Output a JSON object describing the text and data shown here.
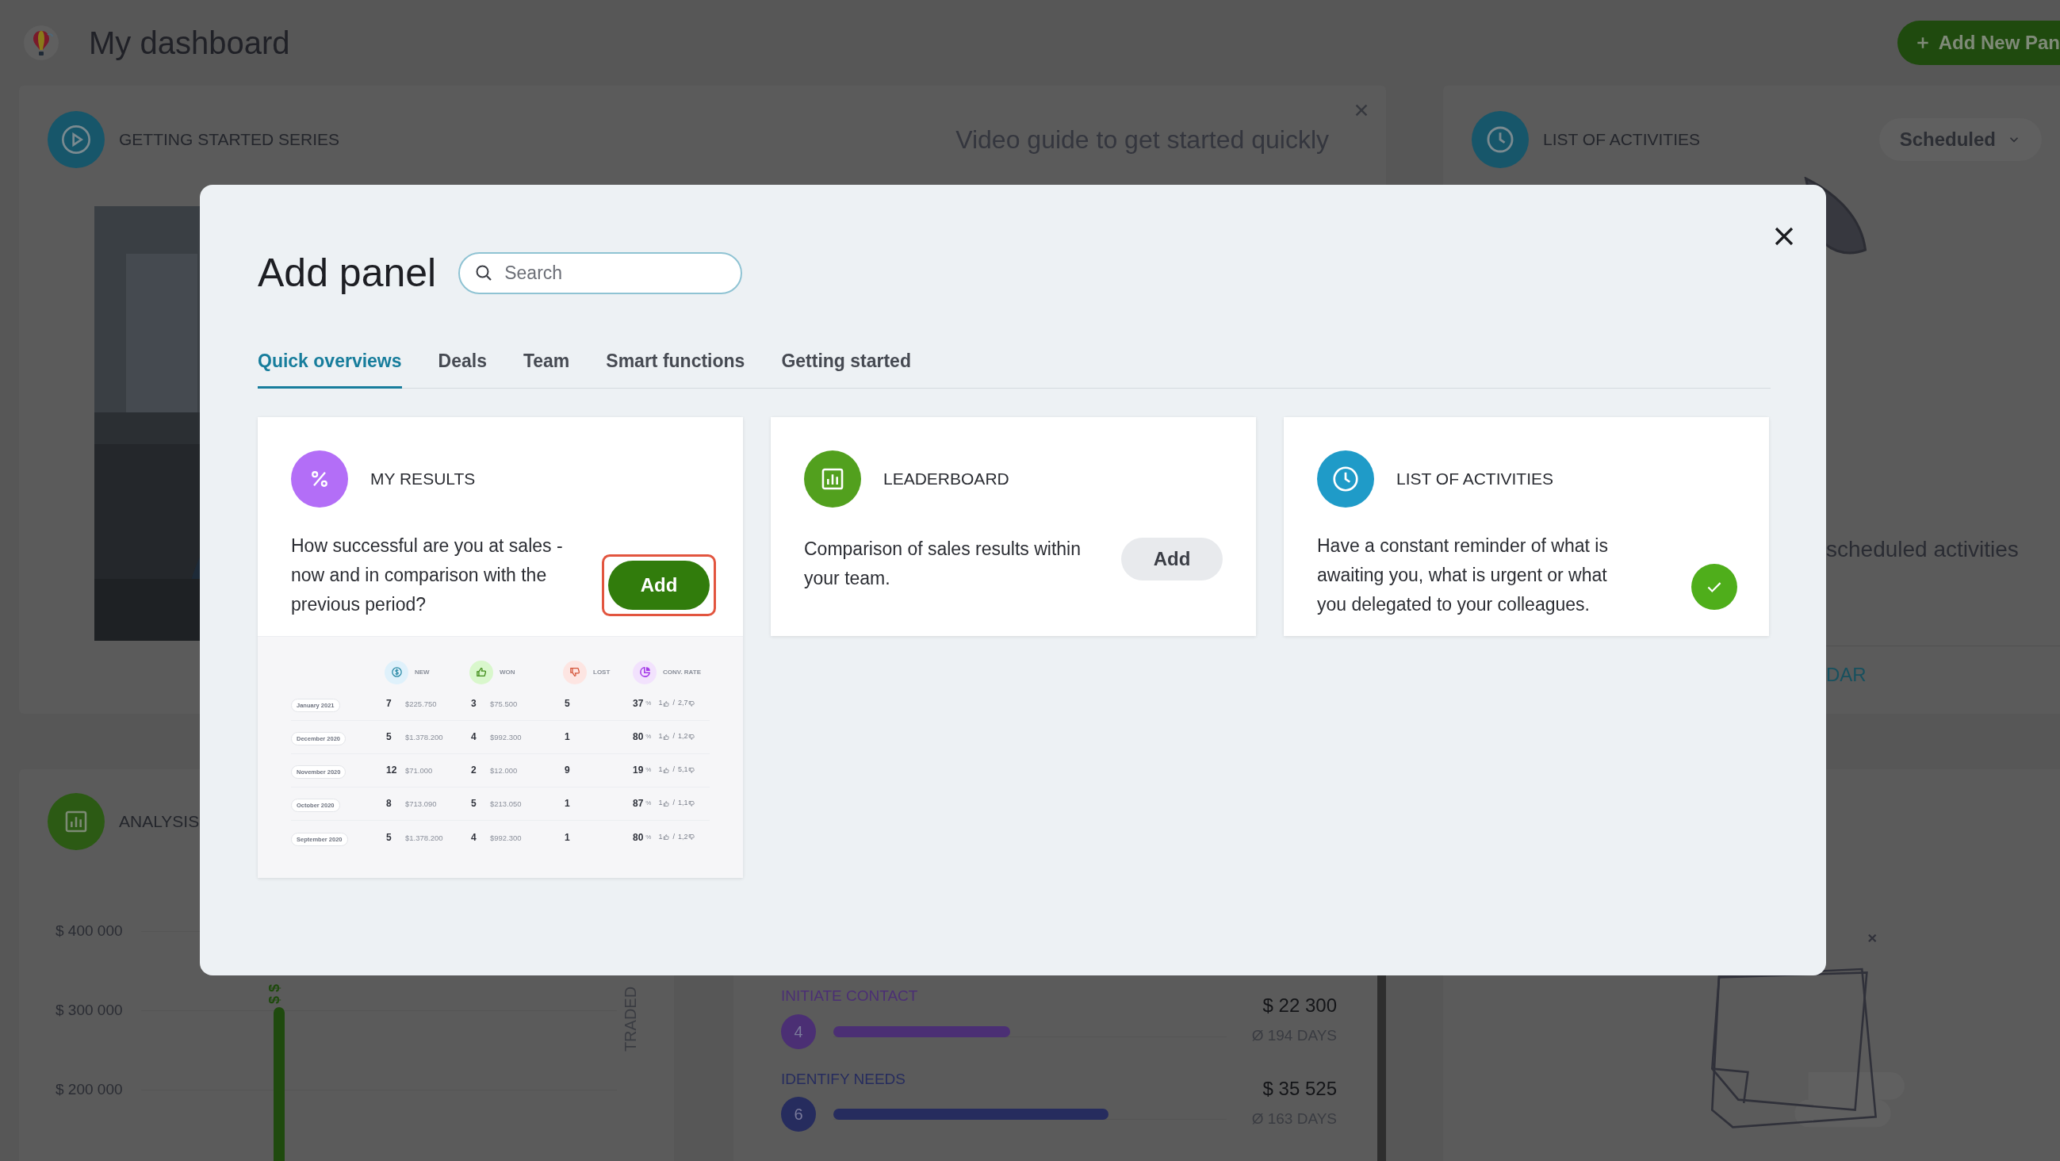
{
  "header": {
    "title": "My dashboard",
    "add_button": "Add New Pan"
  },
  "getting_started": {
    "title": "GETTING STARTED SERIES",
    "subtitle": "Video guide to get started quickly"
  },
  "activities": {
    "title": "LIST OF ACTIVITIES",
    "filter": "Scheduled",
    "message": "scheduled activities",
    "link": "DAR"
  },
  "analysis": {
    "title": "ANALYSIS",
    "y_labels": [
      "$ 400 000",
      "$ 300 000",
      "$ 200 000"
    ],
    "bar_label": "$ $",
    "axis_label": "TRADED"
  },
  "pipeline": {
    "stages": [
      {
        "name": "INITIATE CONTACT",
        "count": "4",
        "level": 0.45,
        "amount": "$ 22 300",
        "duration": "Ø 194 DAYS",
        "color": "#4b2f74"
      },
      {
        "name": "IDENTIFY NEEDS",
        "count": "6",
        "level": 0.7,
        "amount": "$ 35 525",
        "duration": "Ø 163 DAYS",
        "color": "#262c5e"
      }
    ]
  },
  "modal": {
    "title": "Add panel",
    "search": {
      "placeholder": "Search"
    },
    "tabs": [
      {
        "label": "Quick overviews",
        "selected": true
      },
      {
        "label": "Deals",
        "selected": false
      },
      {
        "label": "Team",
        "selected": false
      },
      {
        "label": "Smart functions",
        "selected": false
      },
      {
        "label": "Getting started",
        "selected": false
      }
    ],
    "panels": [
      {
        "kind": "results",
        "title": "MY RESULTS",
        "description": "How successful are you at sales - now and in comparison with the previous period?",
        "color": "#b36ef7",
        "added": false,
        "highlighted": true,
        "button": "Add",
        "preview": {
          "columns": [
            {
              "kind": "new",
              "label": "NEW"
            },
            {
              "kind": "won",
              "label": "WON"
            },
            {
              "kind": "lost",
              "label": "LOST"
            },
            {
              "kind": "rate",
              "label": "CONV. RATE"
            }
          ],
          "rows": [
            {
              "period": "January 2021",
              "new": "7",
              "new_value": "$225.750",
              "won": "3",
              "won_value": "$75.500",
              "lost": "5",
              "rate": "37",
              "unit": "%",
              "ratio_won": "1",
              "separator": "/",
              "ratio_lost": "2,7"
            },
            {
              "period": "December 2020",
              "new": "5",
              "new_value": "$1.378.200",
              "won": "4",
              "won_value": "$992.300",
              "lost": "1",
              "rate": "80",
              "unit": "%",
              "ratio_won": "1",
              "separator": "/",
              "ratio_lost": "1,2"
            },
            {
              "period": "November 2020",
              "new": "12",
              "new_value": "$71.000",
              "won": "2",
              "won_value": "$12.000",
              "lost": "9",
              "rate": "19",
              "unit": "%",
              "ratio_won": "1",
              "separator": "/",
              "ratio_lost": "5,1"
            },
            {
              "period": "October 2020",
              "new": "8",
              "new_value": "$713.090",
              "won": "5",
              "won_value": "$213.050",
              "lost": "1",
              "rate": "87",
              "unit": "%",
              "ratio_won": "1",
              "separator": "/",
              "ratio_lost": "1,1"
            },
            {
              "period": "September 2020",
              "new": "5",
              "new_value": "$1.378.200",
              "won": "4",
              "won_value": "$992.300",
              "lost": "1",
              "rate": "80",
              "unit": "%",
              "ratio_won": "1",
              "separator": "/",
              "ratio_lost": "1,2"
            }
          ]
        }
      },
      {
        "kind": "leaderboard",
        "title": "LEADERBOARD",
        "description": "Comparison of sales results within your team.",
        "color": "#52a01e",
        "added": false,
        "highlighted": false,
        "button": "Add"
      },
      {
        "kind": "activities",
        "title": "LIST OF ACTIVITIES",
        "description": "Have a constant reminder of what is awaiting you, what is urgent or what you delegated to your colleagues.",
        "color": "#1f9bc8",
        "added": true
      }
    ]
  }
}
